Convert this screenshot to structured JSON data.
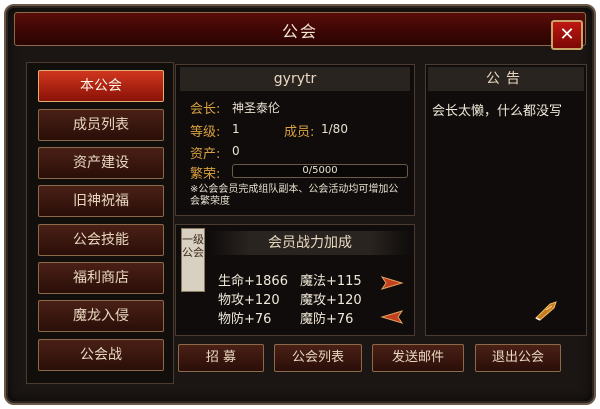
{
  "window": {
    "title": "公会",
    "close_label": "✕"
  },
  "sidebar": {
    "items": [
      {
        "label": "本公会",
        "active": true
      },
      {
        "label": "成员列表",
        "active": false
      },
      {
        "label": "资产建设",
        "active": false
      },
      {
        "label": "旧神祝福",
        "active": false
      },
      {
        "label": "公会技能",
        "active": false
      },
      {
        "label": "福利商店",
        "active": false
      },
      {
        "label": "魔龙入侵",
        "active": false
      },
      {
        "label": "公会战",
        "active": false
      }
    ]
  },
  "guild": {
    "name": "gyrytr",
    "leader_label": "会长:",
    "leader_value": "神圣泰伦",
    "level_label": "等级:",
    "level_value": "1",
    "members_label": "成员:",
    "members_value": "1/80",
    "assets_label": "资产:",
    "assets_value": "0",
    "prosperity_label": "繁荣:",
    "prosperity_value": "0/5000",
    "prosperity_fraction": 0,
    "note": "※公会会员完成组队副本、公会活动均可增加公会繁荣度"
  },
  "notice": {
    "title": "公告",
    "text": "会长太懒，什么都没写",
    "edit_icon": "quill-edit-icon"
  },
  "bonus": {
    "title": "会员战力加成",
    "tier": "一级公会",
    "stats": [
      {
        "text": "生命+1866"
      },
      {
        "text": "魔法+115"
      },
      {
        "text": "物攻+120"
      },
      {
        "text": "魔攻+120"
      },
      {
        "text": "物防+76"
      },
      {
        "text": "魔防+76"
      }
    ],
    "next_icon": "arrow-right-icon",
    "prev_icon": "arrow-left-icon"
  },
  "actions": {
    "recruit": "招 募",
    "guild_list": "公会列表",
    "send_mail": "发送邮件",
    "leave": "退出公会"
  },
  "colors": {
    "accent": "#d8a040",
    "active_tab": "#c0301a",
    "frame_border": "#8a6a48"
  }
}
